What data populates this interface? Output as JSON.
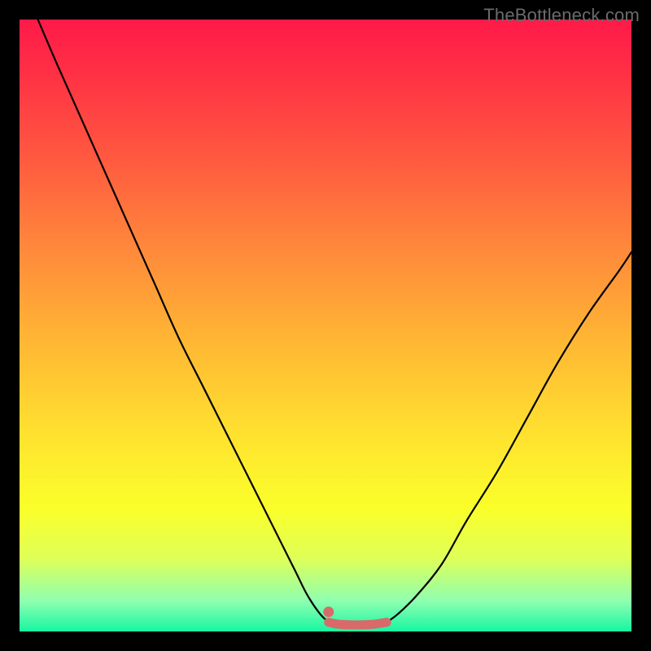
{
  "watermark": "TheBottleneck.com",
  "chart_data": {
    "type": "line",
    "title": "",
    "xlabel": "",
    "ylabel": "",
    "xlim": [
      0,
      100
    ],
    "ylim": [
      0,
      100
    ],
    "series": [
      {
        "name": "left-curve",
        "x": [
          3,
          6,
          10,
          14,
          18,
          22,
          26,
          30,
          34,
          38,
          42,
          45,
          47,
          49,
          50.5
        ],
        "y": [
          100,
          93,
          84,
          75,
          66,
          57,
          48,
          40,
          32,
          24,
          16,
          10,
          6,
          3,
          1.5
        ]
      },
      {
        "name": "right-curve",
        "x": [
          60,
          62,
          65,
          69,
          73,
          78,
          83,
          88,
          93,
          98,
          100
        ],
        "y": [
          1.5,
          3,
          6,
          11,
          18,
          26,
          35,
          44,
          52,
          59,
          62
        ]
      },
      {
        "name": "flat-bottom-pink",
        "x": [
          50.5,
          52,
          54,
          56,
          58,
          60
        ],
        "y": [
          1.5,
          1.2,
          1.1,
          1.1,
          1.2,
          1.5
        ]
      }
    ],
    "marker": {
      "name": "dot",
      "x": 50.5,
      "y": 3.2
    },
    "colors": {
      "curve": "#000000",
      "pink_segment": "#d86a6a",
      "marker": "#d86a6a"
    }
  }
}
